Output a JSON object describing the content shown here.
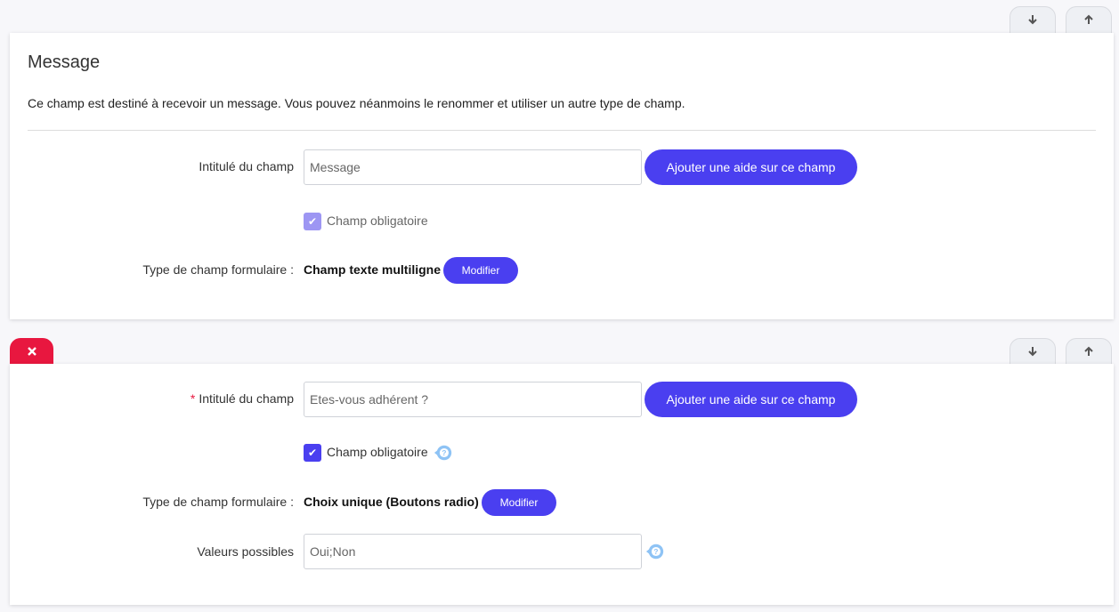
{
  "colors": {
    "accent": "#4a3ff0",
    "danger": "#e8173f",
    "help": "#8ec3f5"
  },
  "field1": {
    "title": "Message",
    "description": "Ce champ est destiné à recevoir un message. Vous pouvez néanmoins le renommer et utiliser un autre type de champ.",
    "label_label": "Intitulé du champ",
    "label_value": "Message",
    "add_help_label": "Ajouter une aide sur ce champ",
    "required_label": "Champ obligatoire",
    "required_checked": true,
    "type_label": "Type de champ formulaire :",
    "type_value": "Champ texte multiligne",
    "modify_label": "Modifier",
    "move_down_icon": "arrow-down-icon",
    "move_up_icon": "arrow-up-icon"
  },
  "field2": {
    "delete_icon": "close-icon",
    "required_marker": "*",
    "label_label": "Intitulé du champ",
    "label_value": "Etes-vous adhérent ?",
    "add_help_label": "Ajouter une aide sur ce champ",
    "required_label": "Champ obligatoire",
    "required_checked": true,
    "type_label": "Type de champ formulaire :",
    "type_value": "Choix unique (Boutons radio)",
    "modify_label": "Modifier",
    "values_label": "Valeurs possibles",
    "values_value": "Oui;Non",
    "move_down_icon": "arrow-down-icon",
    "move_up_icon": "arrow-up-icon"
  }
}
